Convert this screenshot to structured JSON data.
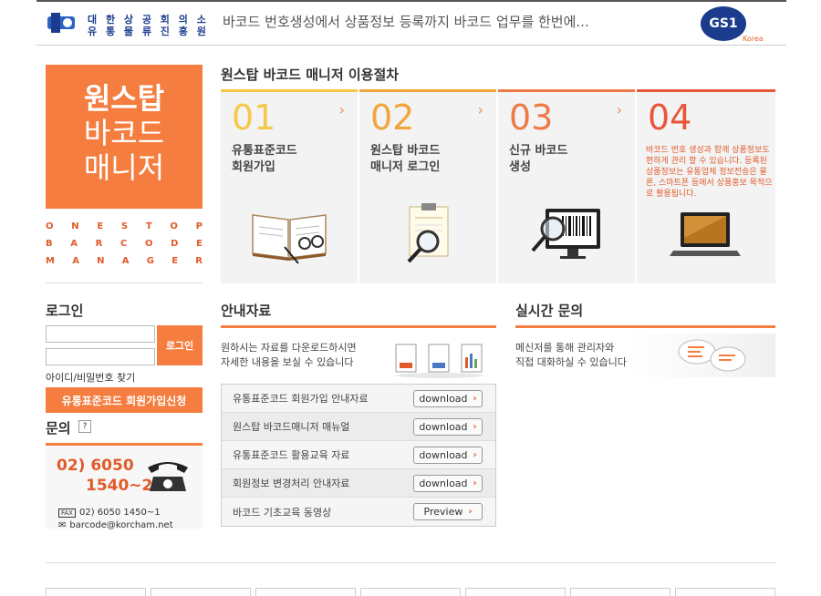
{
  "header": {
    "org_line1": "대 한 상 공 회 의 소",
    "org_line2": "유 통 물 류 진 흥 원",
    "slogan": "바코드 번호생성에서 상품정보 등록까지 바코드 업무를 한번에...",
    "gs1_logo": "GS1",
    "gs1_korea": "Korea"
  },
  "brand": {
    "line1": "원스탑",
    "line2": "바코드",
    "line3": "매니저",
    "sub1": "ONESTOP",
    "sub2": "BARCODE",
    "sub3": "MANAGER"
  },
  "process": {
    "title": "원스탑 바코드 매니저 이용절차",
    "steps": [
      {
        "num": "01",
        "label": "유통표준코드\n회원가입",
        "icon": "book-glasses-icon"
      },
      {
        "num": "02",
        "label": "원스탑 바코드\n매니저 로그인",
        "icon": "certificate-magnifier-icon"
      },
      {
        "num": "03",
        "label": "신규 바코드\n생성",
        "icon": "barcode-monitor-icon"
      },
      {
        "num": "04",
        "desc": "바코드 번호 생성과 함께 상품정보도 편하게 관리 할 수 있습니다. 등록된 상품정보는 유통업체 정보전송은 물론, 스마트폰 등에서 상품홍보 목적으로 활용됩니다.",
        "icon": "laptop-icon"
      }
    ]
  },
  "login": {
    "title": "로그인",
    "button": "로그인",
    "find": "아이디/비밀번호 찾기",
    "join": "유통표준코드 회원가입신청"
  },
  "inquiry": {
    "title": "문의",
    "help": "?",
    "phone1": "02) 6050",
    "phone2": "1540~2",
    "fax": "02) 6050 1450~1",
    "email": "barcode@korcham.net"
  },
  "downloads": {
    "title": "안내자료",
    "desc1": "원하시는 자료를 다운로드하시면",
    "desc2": "자세한 내용을 보실 수 있습니다",
    "items": [
      {
        "name": "유통표준코드 회원가입 안내자료",
        "button": "download"
      },
      {
        "name": "원스탑 바코드매니저 매뉴얼",
        "button": "download"
      },
      {
        "name": "유통표준코드 활용교육 자료",
        "button": "download"
      },
      {
        "name": "회원정보 변경처리 안내자료",
        "button": "download"
      },
      {
        "name": "바코드 기초교육 동영상",
        "button": "Preview"
      }
    ]
  },
  "chat": {
    "title": "실시간 문의",
    "desc1": "메신저를 통해 관리자와",
    "desc2": "직접 대화하실 수 있습니다"
  },
  "colors": {
    "accent": "#f47d3f",
    "step1": "#f5c84a",
    "step2": "#f2a53a",
    "step3": "#ef7a47",
    "step4": "#e9573b",
    "brand_blue": "#1b3c8c"
  }
}
